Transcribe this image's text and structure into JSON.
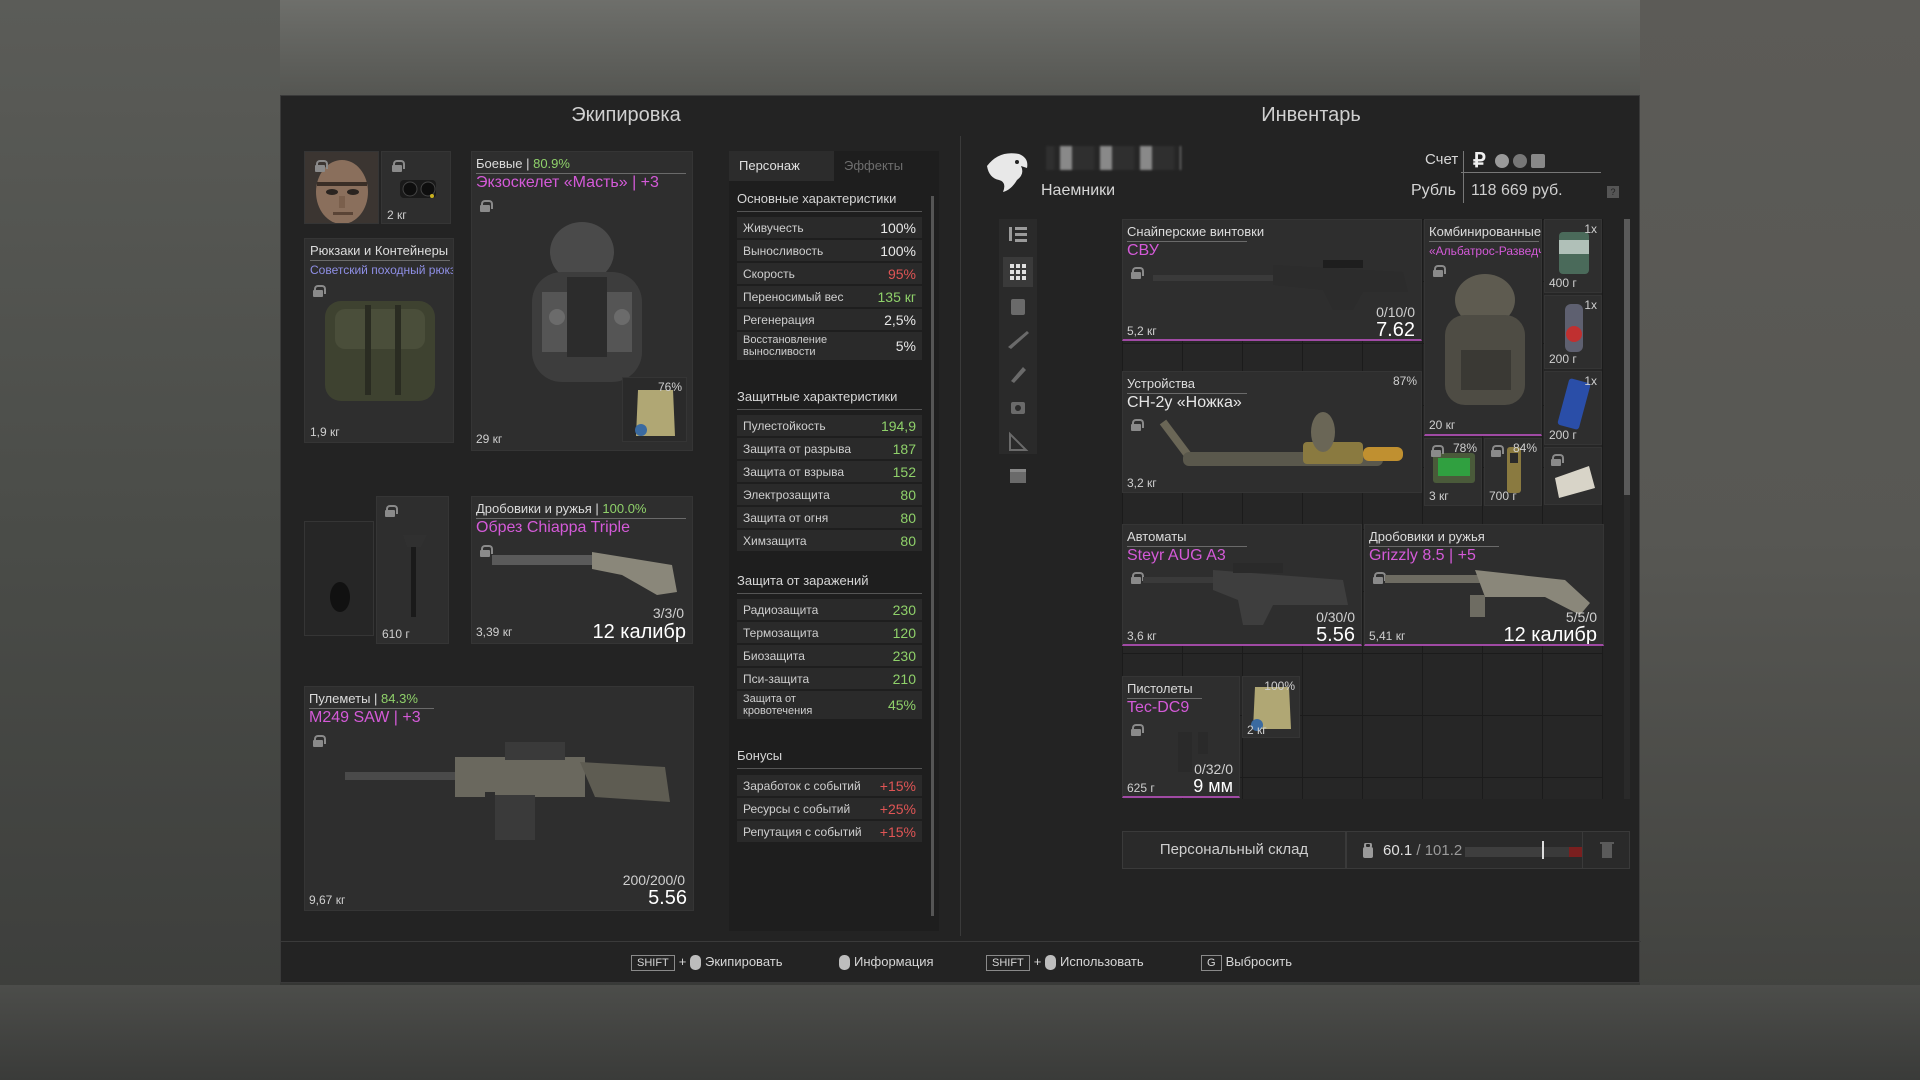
{
  "equipment": {
    "title": "Экипировка",
    "head_slot": {},
    "nv_slot": {
      "weight": "2 кг"
    },
    "armor": {
      "category": "Боевые",
      "pct": "80.9%",
      "name": "Экзоскелет «Масть» | +3",
      "weight": "29 кг",
      "plate_pct": "76%"
    },
    "backpack": {
      "category": "Рюкзаки и Контейнеры",
      "name": "Советский походный рюкз...",
      "weight": "1,9 кг"
    },
    "melee": {
      "weight": "610 г"
    },
    "shotgun": {
      "category": "Дробовики и ружья",
      "pct": "100.0%",
      "name": "Обрез Chiappa Triple",
      "weight": "3,39 кг",
      "ammo": "3/3/0",
      "caliber": "12 калибр"
    },
    "mg": {
      "category": "Пулеметы",
      "pct": "84.3%",
      "name": "M249 SAW | +3",
      "weight": "9,67 кг",
      "ammo": "200/200/0",
      "caliber": "5.56"
    }
  },
  "stats": {
    "tabs": [
      "Персонаж",
      "Эффекты"
    ],
    "groups": [
      {
        "title": "Основные характеристики",
        "rows": [
          {
            "label": "Живучесть",
            "value": "100%",
            "color": "w"
          },
          {
            "label": "Выносливость",
            "value": "100%",
            "color": "w"
          },
          {
            "label": "Скорость",
            "value": "95%",
            "color": "r"
          },
          {
            "label": "Переносимый вес",
            "value": "135 кг",
            "color": "g"
          },
          {
            "label": "Регенерация",
            "value": "2,5%",
            "color": "w"
          },
          {
            "label": "Восстановление выносливости",
            "value": "5%",
            "color": "w"
          }
        ]
      },
      {
        "title": "Защитные характеристики",
        "rows": [
          {
            "label": "Пулестойкость",
            "value": "194,9",
            "color": "g"
          },
          {
            "label": "Защита от разрыва",
            "value": "187",
            "color": "g"
          },
          {
            "label": "Защита от взрыва",
            "value": "152",
            "color": "g"
          },
          {
            "label": "Электрозащита",
            "value": "80",
            "color": "g"
          },
          {
            "label": "Защита от огня",
            "value": "80",
            "color": "g"
          },
          {
            "label": "Химзащита",
            "value": "80",
            "color": "g"
          }
        ]
      },
      {
        "title": "Защита от заражений",
        "rows": [
          {
            "label": "Радиозащита",
            "value": "230",
            "color": "g"
          },
          {
            "label": "Термозащита",
            "value": "120",
            "color": "g"
          },
          {
            "label": "Биозащита",
            "value": "230",
            "color": "g"
          },
          {
            "label": "Пси-защита",
            "value": "210",
            "color": "g"
          },
          {
            "label": "Защита от кровотечения",
            "value": "45%",
            "color": "g"
          }
        ]
      },
      {
        "title": "Бонусы",
        "rows": [
          {
            "label": "Заработок с событий",
            "value": "+15%",
            "color": "r"
          },
          {
            "label": "Ресурсы с событий",
            "value": "+25%",
            "color": "r"
          },
          {
            "label": "Репутация с событий",
            "value": "+15%",
            "color": "r"
          }
        ]
      }
    ]
  },
  "inventory": {
    "title": "Инвентарь",
    "account_label": "Счет",
    "faction": "Наемники",
    "currency_label": "Рубль",
    "money": "118 669 руб.",
    "ruble_symbol": "₽",
    "help": "?",
    "items": {
      "sniper": {
        "category": "Снайперские винтовки",
        "name": "СВУ",
        "weight": "5,2 кг",
        "ammo": "0/10/0",
        "caliber": "7.62"
      },
      "combined": {
        "category": "Комбинированные",
        "name": "«Альбатрос-Разведчик...",
        "weight": "20 кг"
      },
      "can1": {
        "qty": "1x",
        "weight": "400 г"
      },
      "can2": {
        "qty": "1x",
        "weight": "200 г"
      },
      "can3": {
        "qty": "1x",
        "weight": "200 г"
      },
      "device": {
        "category": "Устройства",
        "name": "СН-2у «Ножка»",
        "weight": "3,2 кг",
        "pct": "87%"
      },
      "detector1": {
        "pct": "78%",
        "weight": "3 кг"
      },
      "detector2": {
        "pct": "84%",
        "weight": "700 г"
      },
      "rifle": {
        "category": "Автоматы",
        "name": "Steyr AUG A3",
        "weight": "3,6 кг",
        "ammo": "0/30/0",
        "caliber": "5.56"
      },
      "shotgun2": {
        "category": "Дробовики и ружья",
        "name": "Grizzly 8.5 | +5",
        "weight": "5,41 кг",
        "ammo": "5/5/0",
        "caliber": "12 калибр"
      },
      "pistol": {
        "category": "Пистолеты",
        "name": "Tec-DC9",
        "weight": "625 г",
        "ammo": "0/32/0",
        "caliber": "9 мм"
      },
      "plate": {
        "pct": "100%",
        "weight": "2 кг"
      }
    },
    "stash_label": "Персональный склад",
    "weight_current": "60.1",
    "weight_total": "/ 101.2",
    "weight_fraction": 0.594
  },
  "controls": [
    {
      "key": "SHIFT",
      "plus": "+",
      "label": "Экипировать"
    },
    {
      "label": "Информация"
    },
    {
      "key": "SHIFT",
      "plus": "+",
      "label": "Использовать"
    },
    {
      "key": "G",
      "label": "Выбросить"
    }
  ],
  "colors": {
    "accent_purple": "#d45ad8",
    "green": "#8fd16a",
    "red": "#e05555"
  }
}
